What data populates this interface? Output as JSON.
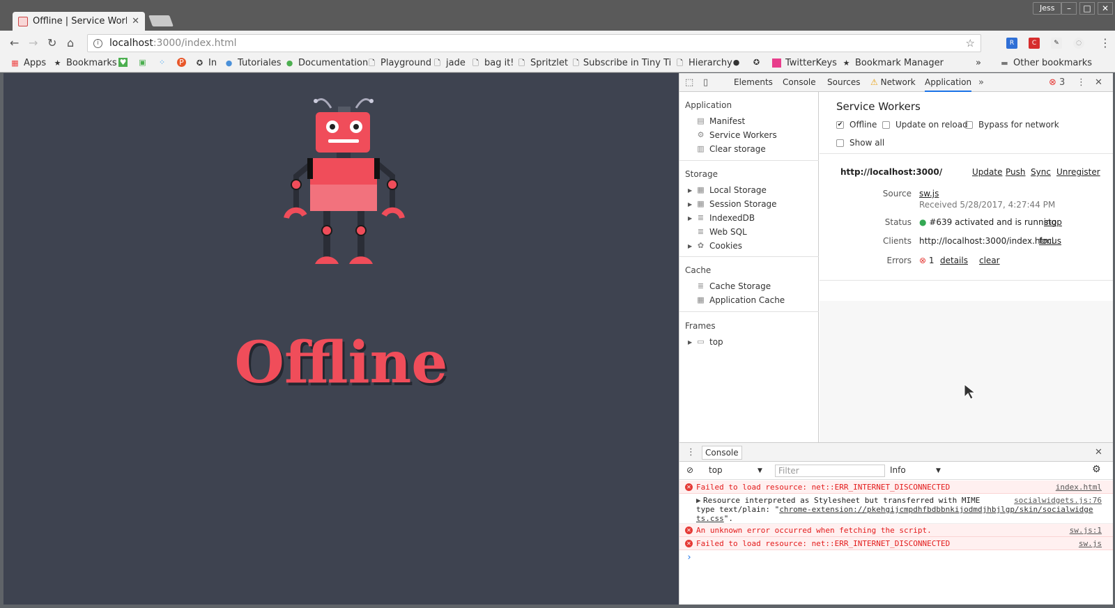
{
  "browser": {
    "tab_title": "Offline | Service Worke",
    "user": "Jess",
    "url_host": "localhost",
    "url_path": ":3000/index.html",
    "bookmarks": [
      "Apps",
      "Bookmarks",
      "In",
      "Tutoriales",
      "Documentation",
      "Playground",
      "jade",
      "bag it!",
      "Spritzlet",
      "Subscribe in Tiny Ti",
      "Hierarchy",
      "TwitterKeys",
      "Bookmark Manager"
    ],
    "other_bookmarks": "Other bookmarks",
    "overflow": "»"
  },
  "page": {
    "heading": "Offline"
  },
  "devtools": {
    "tabs": [
      "Elements",
      "Console",
      "Sources",
      "Network",
      "Application"
    ],
    "error_count": "3",
    "sidebar": {
      "application_header": "Application",
      "application_items": [
        "Manifest",
        "Service Workers",
        "Clear storage"
      ],
      "storage_header": "Storage",
      "storage_items": [
        "Local Storage",
        "Session Storage",
        "IndexedDB",
        "Web SQL",
        "Cookies"
      ],
      "cache_header": "Cache",
      "cache_items": [
        "Cache Storage",
        "Application Cache"
      ],
      "frames_header": "Frames",
      "frames_items": [
        "top"
      ]
    },
    "service_workers": {
      "title": "Service Workers",
      "offline": "Offline",
      "update_on_reload": "Update on reload",
      "bypass_for_network": "Bypass for network",
      "show_all": "Show all",
      "scope": "http://localhost:3000/",
      "actions": [
        "Update",
        "Push",
        "Sync",
        "Unregister"
      ],
      "source_label": "Source",
      "source_file": "sw.js",
      "received": "Received 5/28/2017, 4:27:44 PM",
      "status_label": "Status",
      "status_text": "#639 activated and is running",
      "stop": "stop",
      "clients_label": "Clients",
      "clients_url": "http://localhost:3000/index.html",
      "focus": "focus",
      "errors_label": "Errors",
      "errors_count": "1",
      "details": "details",
      "clear": "clear"
    },
    "drawer": {
      "tab": "Console",
      "context": "top",
      "filter_placeholder": "Filter",
      "level": "Info",
      "messages": [
        {
          "text": "Failed to load resource: net::ERR_INTERNET_DISCONNECTED",
          "source": "index.html"
        },
        {
          "text": "Resource interpreted as Stylesheet but transferred with MIME",
          "text2": "type text/plain: \"",
          "link": "chrome-extension://pkehgijcmpdhfbdbbnkijodmdjhbjlgp/skin/socialwidge",
          "text3": "ts.css",
          "text4": "\".",
          "source": "socialwidgets.js:76"
        },
        {
          "text": "An unknown error occurred when fetching the script.",
          "source": "sw.js:1"
        },
        {
          "text": "Failed to load resource: net::ERR_INTERNET_DISCONNECTED",
          "source": "sw.js"
        }
      ],
      "prompt": "›"
    }
  },
  "colors": {
    "page_bg": "#3e4350",
    "robot_red": "#f04d5a",
    "link": "#1155cc",
    "error": "#e31a1a"
  }
}
